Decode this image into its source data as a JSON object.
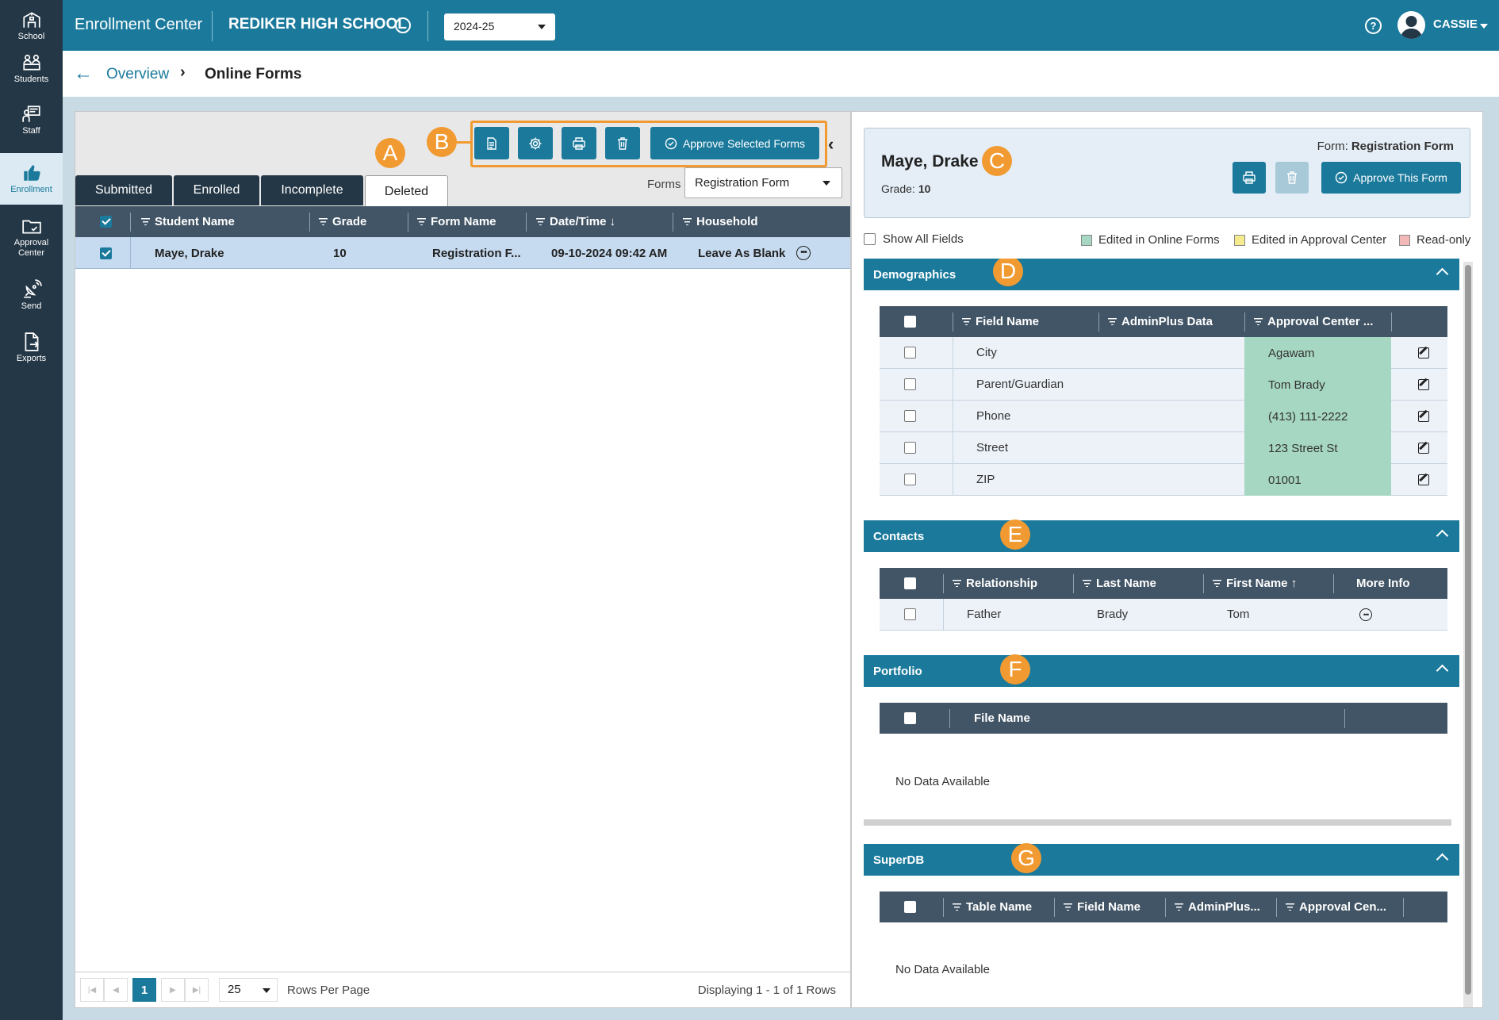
{
  "sidebar": {
    "items": [
      {
        "label": "School",
        "icon": "school-icon"
      },
      {
        "label": "Students",
        "icon": "students-icon"
      },
      {
        "label": "Staff",
        "icon": "staff-icon"
      },
      {
        "label": "Enrollment",
        "icon": "thumbs-up-icon",
        "active": true
      },
      {
        "label": "Approval Center",
        "icon": "folder-icon"
      },
      {
        "label": "Send",
        "icon": "satellite-icon"
      },
      {
        "label": "Exports",
        "icon": "export-icon"
      }
    ]
  },
  "header": {
    "app_title": "Enrollment Center",
    "school_name": "REDIKER HIGH SCHOOL",
    "year": "2024-25",
    "help": "?",
    "user": "CASSIE"
  },
  "breadcrumb": {
    "back": "←",
    "parent": "Overview",
    "current": "Online Forms"
  },
  "callouts": {
    "a": "A",
    "b": "B",
    "c": "C",
    "d": "D",
    "e": "E",
    "f": "F",
    "g": "G"
  },
  "toolbar": {
    "approve_selected": "Approve Selected Forms",
    "collapse": "‹"
  },
  "tabs": [
    "Submitted",
    "Enrolled",
    "Incomplete",
    "Deleted"
  ],
  "active_tab": "Deleted",
  "forms_filter": {
    "label": "Forms",
    "value": "Registration Form"
  },
  "grid": {
    "columns": [
      "Student Name",
      "Grade",
      "Form Name",
      "Date/Time ↓",
      "Household"
    ],
    "rows": [
      {
        "student": "Maye, Drake",
        "grade": "10",
        "form": "Registration F...",
        "datetime": "09-10-2024 09:42 AM",
        "household": "Leave As Blank"
      }
    ]
  },
  "pager": {
    "page": "1",
    "rows_per_page": "25",
    "rows_per_page_label": "Rows Per Page",
    "display": "Displaying 1 - 1 of 1 Rows"
  },
  "detail": {
    "student_name": "Maye, Drake",
    "grade_label": "Grade:",
    "grade": "10",
    "form_label": "Form:",
    "form": "Registration Form",
    "approve_this": "Approve This Form",
    "show_all": "Show All Fields",
    "legend": [
      {
        "label": "Edited in Online Forms",
        "color": "#a6d7c3"
      },
      {
        "label": "Edited in Approval Center",
        "color": "#f5ea8e"
      },
      {
        "label": "Read-only",
        "color": "#f2b8b8"
      }
    ]
  },
  "demographics": {
    "title": "Demographics",
    "columns": [
      "Field Name",
      "AdminPlus Data",
      "Approval Center ..."
    ],
    "rows": [
      {
        "field": "City",
        "adminplus": "",
        "approval": "Agawam"
      },
      {
        "field": "Parent/Guardian",
        "adminplus": "",
        "approval": "Tom Brady"
      },
      {
        "field": "Phone",
        "adminplus": "",
        "approval": "(413) 111-2222"
      },
      {
        "field": "Street",
        "adminplus": "",
        "approval": "123 Street St"
      },
      {
        "field": "ZIP",
        "adminplus": "",
        "approval": "01001"
      }
    ]
  },
  "contacts": {
    "title": "Contacts",
    "columns": [
      "Relationship",
      "Last Name",
      "First Name ↑",
      "More Info"
    ],
    "rows": [
      {
        "relationship": "Father",
        "last": "Brady",
        "first": "Tom"
      }
    ]
  },
  "portfolio": {
    "title": "Portfolio",
    "columns": [
      "File Name"
    ],
    "empty": "No Data Available"
  },
  "superdb": {
    "title": "SuperDB",
    "columns": [
      "Table Name",
      "Field Name",
      "AdminPlus...",
      "Approval Cen..."
    ],
    "empty": "No Data Available"
  }
}
